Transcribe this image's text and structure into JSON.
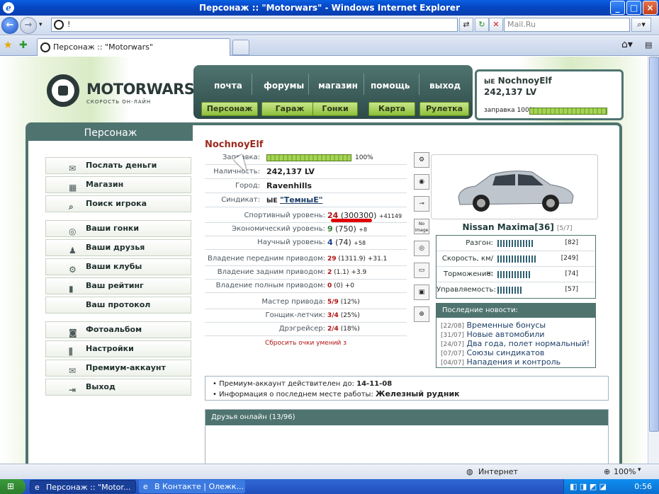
{
  "window": {
    "title": "Персонаж :: \"Motorwars\" - Windows Internet Explorer"
  },
  "browser": {
    "address": "!",
    "search_placeholder": "Mail.Ru",
    "tab_label": "Персонаж :: \"Motorwars\""
  },
  "site": {
    "logo": "MOTORWARS.RU",
    "tagline": "СКОРОСТЬ ОН-ЛАЙН",
    "top_menu": [
      "почта",
      "форумы",
      "магазин",
      "помощь",
      "выход"
    ],
    "sub_menu": [
      "Персонаж",
      "Гараж",
      "Гонки",
      "Карта",
      "Рулетка"
    ],
    "user": {
      "nick": "NochnoyElf",
      "clan_tag": "ЫЕ",
      "money": "242,137 LV",
      "fuel_label": "заправка 100%",
      "fuel_value": 1.0
    }
  },
  "panel": {
    "title": "Персонаж"
  },
  "sidebar": [
    "Послать деньги",
    "Магазин",
    "Поиск игрока",
    "Ваши гонки",
    "Ваши друзья",
    "Ваши клубы",
    "Ваш рейтинг",
    "Ваш протокол",
    "Фотоальбом",
    "Настройки",
    "Премиум-аккаунт",
    "Выход"
  ],
  "character": {
    "name": "NochnoyElf",
    "fuel_label": "Заправка:",
    "fuel_pct": "100%",
    "fuel_value": 1.0,
    "cash_label": "Наличность:",
    "cash": "242,137 LV",
    "city_label": "Город:",
    "city": "Ravenhills",
    "syndicate_label": "Синдикат:",
    "syndicate_tag": "ЫЕ",
    "syndicate": "\"ТемныЕ\"",
    "sport_label": "Спортивный уровень:",
    "sport_lvl": "24",
    "sport_pts": "(300300)",
    "sport_plus": "+41149",
    "eco_label": "Экономический уровень:",
    "eco_lvl": "9",
    "eco_pts": "(750)",
    "eco_plus": "+8",
    "sci_label": "Научный уровень:",
    "sci_lvl": "4",
    "sci_pts": "(74)",
    "sci_plus": "+58",
    "fwd_label": "Владение передним приводом:",
    "fwd_lvl": "29",
    "fwd_pts": "(1311.9)",
    "fwd_plus": "+31.1",
    "rwd_label": "Владение задним приводом:",
    "rwd_lvl": "2",
    "rwd_pts": "(1.1)",
    "rwd_plus": "+3.9",
    "awd_label": "Владение полным приводом:",
    "awd_lvl": "0",
    "awd_pts": "(0)",
    "awd_plus": "+0",
    "master_label": "Мастер привода:",
    "master": "5/9",
    "master_pct": "(12%)",
    "pilot_label": "Гонщик-летчик:",
    "pilot": "3/4",
    "pilot_pct": "(25%)",
    "drag_label": "Дрэгрейсер:",
    "drag": "2/4",
    "drag_pct": "(18%)",
    "reset": "Сбросить очки умений з"
  },
  "car": {
    "name": "Nissan Maxima[36]",
    "slot": "[5/7]",
    "stats": [
      {
        "label": "Разгон:",
        "value": "[82]"
      },
      {
        "label": "Скорость, км/ч:",
        "value": "[249]"
      },
      {
        "label": "Торможение:",
        "value": "[74]"
      },
      {
        "label": "Управляемость:",
        "value": "[57]"
      }
    ]
  },
  "news": {
    "title": "Последние новости:",
    "items": [
      {
        "date": "[22/08]",
        "text": "Временные бонусы"
      },
      {
        "date": "[31/07]",
        "text": "Новые автомобили"
      },
      {
        "date": "[24/07]",
        "text": "Два года, полет нормальный!"
      },
      {
        "date": "[07/07]",
        "text": "Союзы синдикатов"
      },
      {
        "date": "[04/07]",
        "text": "Нападения и контроль"
      }
    ]
  },
  "info": {
    "premium_label": "Премиум-аккаунт действителен до:",
    "premium_date": "14-11-08",
    "work_label": "Информация о последнем месте работы:",
    "work": "Железный рудник"
  },
  "friends": {
    "title": "Друзья онлайн (13/96)"
  },
  "status": {
    "zone": "Интернет",
    "zoom": "100%"
  },
  "taskbar": {
    "item1": "Персонаж :: \"Motor...",
    "item2": "В Контакте | Олежк...",
    "lang": "RU",
    "clock": "0:56"
  },
  "icons": {
    "no_image": "No image"
  }
}
